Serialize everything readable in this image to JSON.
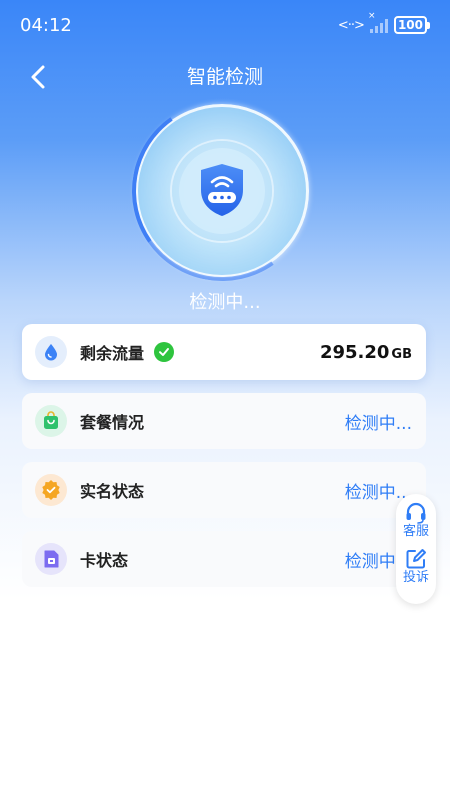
{
  "status_bar": {
    "time": "04:12",
    "battery": "100"
  },
  "header": {
    "title": "智能检测"
  },
  "scan": {
    "status": "检测中..."
  },
  "cards": [
    {
      "label": "剩余流量",
      "value": "295.20",
      "unit": "GB",
      "verified": true
    },
    {
      "label": "套餐情况",
      "status": "检测中..."
    },
    {
      "label": "实名状态",
      "status": "检测中..."
    },
    {
      "label": "卡状态",
      "status": "检测中..."
    }
  ],
  "float_panel": {
    "service_label": "客服",
    "complaint_label": "投诉"
  },
  "colors": {
    "accent": "#2f7df6",
    "check": "#2ec43e",
    "header_top": "#3a86f8"
  },
  "icons": [
    "back-arrow-icon",
    "wifi-shield-icon",
    "water-drop-icon",
    "shopping-bag-icon",
    "verified-badge-icon",
    "sim-card-icon",
    "headset-icon",
    "edit-icon",
    "check-icon"
  ]
}
